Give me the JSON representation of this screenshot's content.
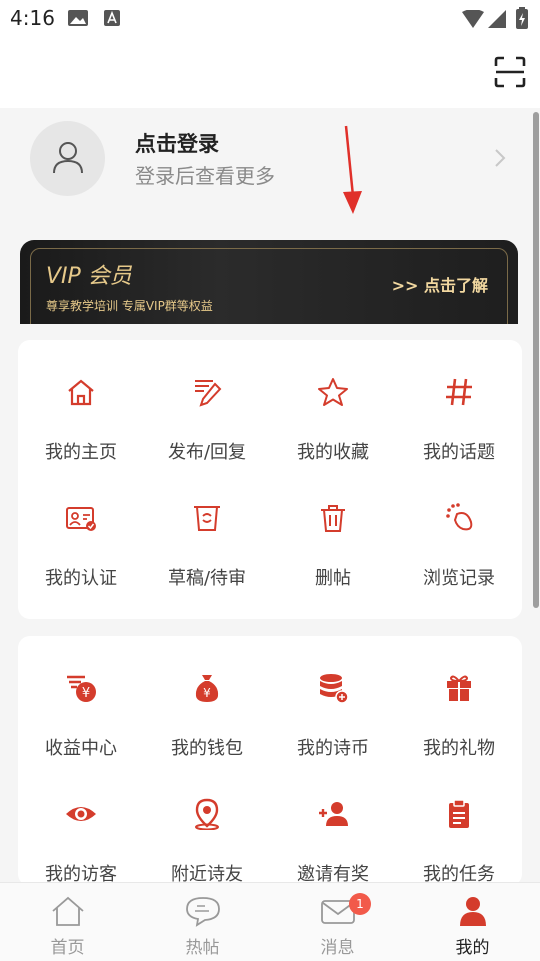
{
  "status_bar": {
    "time": "4:16"
  },
  "profile": {
    "title": "点击登录",
    "subtitle": "登录后查看更多"
  },
  "vip_banner": {
    "title": "VIP 会员",
    "subtitle": "尊享教学培训 专属VIP群等权益",
    "link": ">> 点击了解"
  },
  "menu1": [
    {
      "label": "我的主页",
      "icon": "home-icon"
    },
    {
      "label": "发布/回复",
      "icon": "edit-icon"
    },
    {
      "label": "我的收藏",
      "icon": "star-icon"
    },
    {
      "label": "我的话题",
      "icon": "hashtag-icon"
    },
    {
      "label": "我的认证",
      "icon": "id-card-icon"
    },
    {
      "label": "草稿/待审",
      "icon": "draft-icon"
    },
    {
      "label": "删帖",
      "icon": "trash-icon"
    },
    {
      "label": "浏览记录",
      "icon": "footprint-icon"
    }
  ],
  "menu2": [
    {
      "label": "收益中心",
      "icon": "income-icon"
    },
    {
      "label": "我的钱包",
      "icon": "wallet-icon"
    },
    {
      "label": "我的诗币",
      "icon": "coins-icon"
    },
    {
      "label": "我的礼物",
      "icon": "gift-icon"
    },
    {
      "label": "我的访客",
      "icon": "eye-icon"
    },
    {
      "label": "附近诗友",
      "icon": "location-icon"
    },
    {
      "label": "邀请有奖",
      "icon": "invite-icon"
    },
    {
      "label": "我的任务",
      "icon": "task-icon"
    }
  ],
  "tabs": [
    {
      "label": "首页",
      "icon": "home-tab-icon"
    },
    {
      "label": "热帖",
      "icon": "chat-tab-icon"
    },
    {
      "label": "消息",
      "icon": "mail-tab-icon",
      "badge": "1"
    },
    {
      "label": "我的",
      "icon": "user-tab-icon"
    }
  ],
  "colors": {
    "accent": "#d43c2c",
    "gold": "#e6c98a"
  }
}
